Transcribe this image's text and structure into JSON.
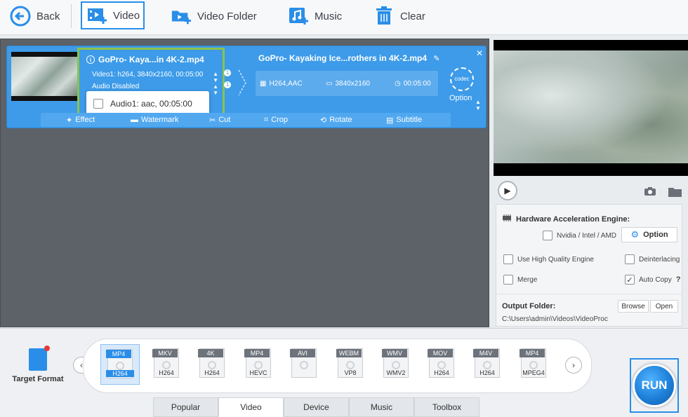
{
  "toolbar": {
    "back": "Back",
    "video": "Video",
    "video_folder": "Video Folder",
    "music": "Music",
    "clear": "Clear"
  },
  "file": {
    "source_title": "GoPro- Kaya...in 4K-2.mp4",
    "video_track": "Video1: h264, 3840x2160, 00:05:00",
    "audio_state": "Audio Disabled",
    "audio_track": "Audio1: aac, 00:05:00",
    "track_badge": "1",
    "output_title": "GoPro- Kayaking Ice...rothers in 4K-2.mp4",
    "output_codec": "H264,AAC",
    "output_res": "3840x2160",
    "output_duration": "00:05:00",
    "codec_label": "codec",
    "option_label": "Option",
    "actions": [
      "Effect",
      "Watermark",
      "Cut",
      "Crop",
      "Rotate",
      "Subtitle"
    ]
  },
  "settings": {
    "hw_title": "Hardware Acceleration Engine:",
    "hw_option": "Nvidia / Intel / AMD",
    "option_btn": "Option",
    "high_quality": "Use High Quality Engine",
    "deinterlacing": "Deinterlacing",
    "merge": "Merge",
    "auto_copy": "Auto Copy",
    "help": "?",
    "output_folder_label": "Output Folder:",
    "output_path": "C:\\Users\\admin\\Videos\\VideoProc",
    "browse": "Browse",
    "open": "Open"
  },
  "target": {
    "label": "Target Format"
  },
  "formats": [
    {
      "tag": "MP4",
      "sub": "H264"
    },
    {
      "tag": "MKV",
      "sub": "H264"
    },
    {
      "tag": "4K",
      "sub": "H264"
    },
    {
      "tag": "MP4",
      "sub": "HEVC"
    },
    {
      "tag": "AVI",
      "sub": ""
    },
    {
      "tag": "WEBM",
      "sub": "VP8"
    },
    {
      "tag": "WMV",
      "sub": "WMV2"
    },
    {
      "tag": "MOV",
      "sub": "H264"
    },
    {
      "tag": "M4V",
      "sub": "H264"
    },
    {
      "tag": "MP4",
      "sub": "MPEG4"
    }
  ],
  "tabs": [
    "Popular",
    "Video",
    "Device",
    "Music",
    "Toolbox"
  ],
  "run": "RUN"
}
